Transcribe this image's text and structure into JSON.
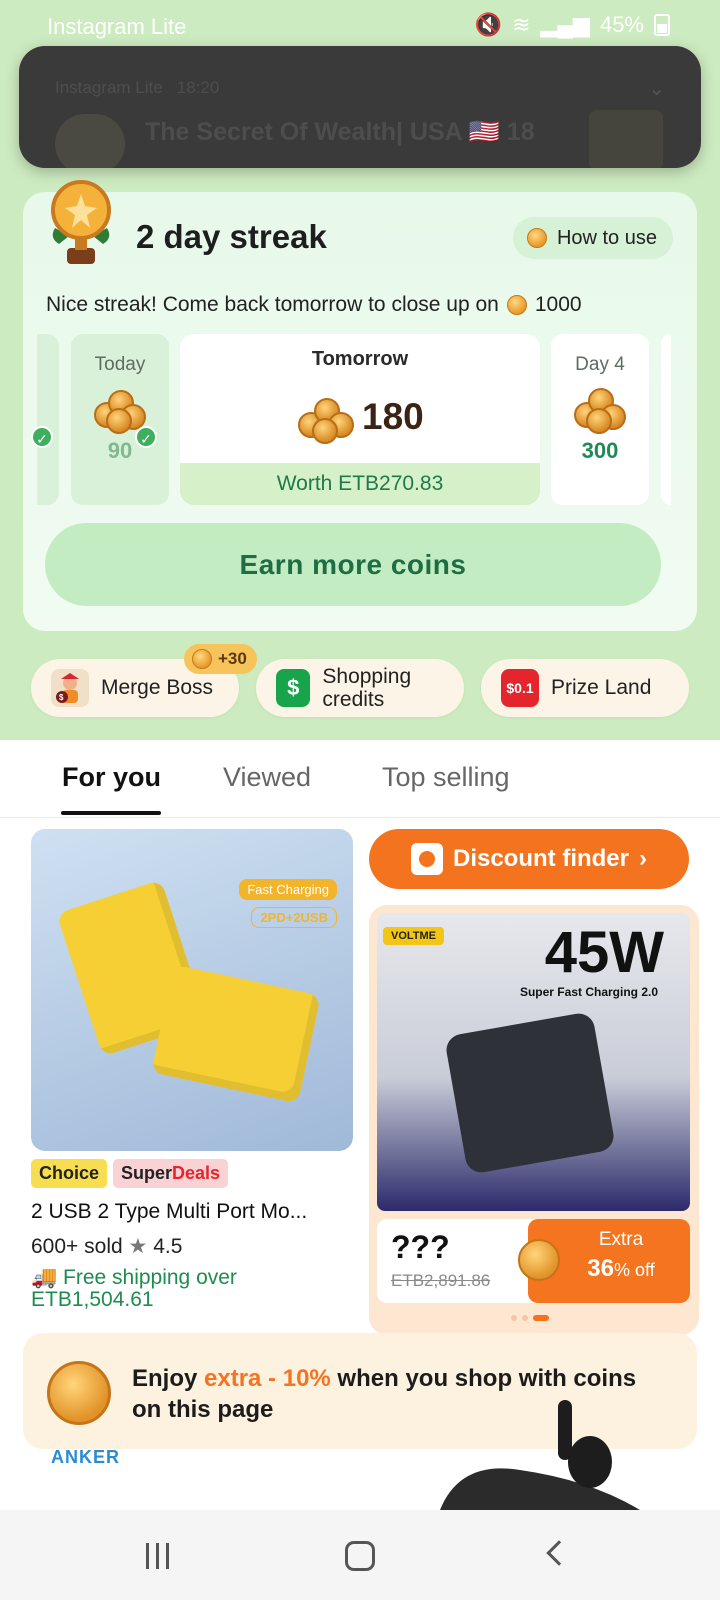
{
  "statusbar": {
    "app_name": "Instagram Lite",
    "battery": "45%"
  },
  "notification": {
    "app": "Instagram Lite",
    "time": "18:20",
    "title": "The Secret Of Wealth| USA 🇺🇸 18"
  },
  "streak": {
    "title": "2 day streak",
    "how_to_use": "How to use",
    "message": "Nice streak! Come back tomorrow to close up on",
    "target": "1000",
    "today_label": "Today",
    "today_value": "90",
    "tomorrow_label": "Tomorrow",
    "tomorrow_value": "180",
    "tomorrow_worth": "Worth ETB270.83",
    "day4_label": "Day 4",
    "day4_value": "300",
    "earn_button": "Earn more coins"
  },
  "shortcuts": {
    "merge_boss": "Merge Boss",
    "merge_bonus": "+30",
    "shopping_credits": "Shopping credits",
    "prize_land": "Prize Land",
    "prize_icon_text": "$0.1"
  },
  "tabs": {
    "for_you": "For you",
    "viewed": "Viewed",
    "top_selling": "Top selling"
  },
  "product_left": {
    "fast_charging": "Fast Charging",
    "ports": "2PD+2USB",
    "badge_choice": "Choice",
    "badge_super": "Super",
    "badge_deals": "Deals",
    "title": "2 USB 2 Type Multi Port Mo...",
    "sold": "600+ sold",
    "rating": "4.5",
    "shipping": "Free shipping over ETB1,504.61"
  },
  "discount_finder": {
    "label": "Discount finder"
  },
  "deal": {
    "brand": "VOLTME",
    "wattage": "45W",
    "subtitle": "Super Fast Charging 2.0",
    "price_hidden": "???",
    "original_price": "ETB2,891.86",
    "extra_label": "Extra",
    "extra_pct": "36",
    "extra_suffix": "% off"
  },
  "promo": {
    "text_prefix": "Enjoy ",
    "text_highlight": "extra - 10%",
    "text_suffix": " when you shop with coins on this page"
  },
  "bottom": {
    "brand": "ANKER"
  }
}
